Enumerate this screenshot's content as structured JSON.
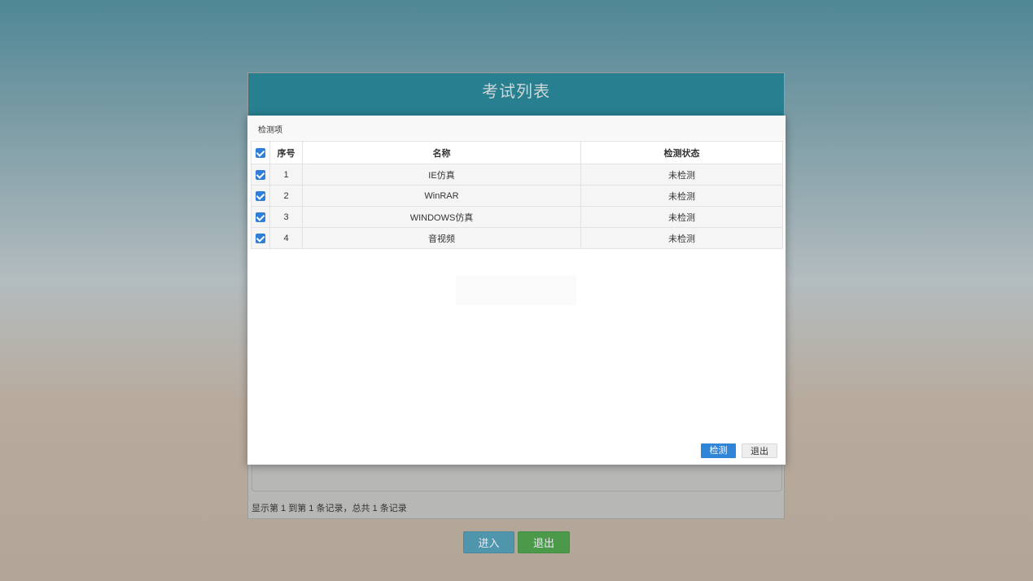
{
  "page": {
    "title": "考试列表",
    "footer_text": "显示第 1 到第 1 条记录，总共 1 条记录",
    "enter_label": "进入",
    "exit_label": "退出"
  },
  "modal": {
    "title": "检测项",
    "columns": [
      "序号",
      "名称",
      "检测状态"
    ],
    "rows": [
      {
        "index": "1",
        "name": "IE仿真",
        "status": "未检测",
        "checked": true
      },
      {
        "index": "2",
        "name": "WinRAR",
        "status": "未检测",
        "checked": true
      },
      {
        "index": "3",
        "name": "WINDOWS仿真",
        "status": "未检测",
        "checked": true
      },
      {
        "index": "4",
        "name": "音视频",
        "status": "未检测",
        "checked": true
      }
    ],
    "detect_label": "检测",
    "quit_label": "退出"
  },
  "colors": {
    "header_teal": "#287f8f",
    "checkbox_blue": "#2f7fd8",
    "detect_blue": "#2f86d8",
    "exit_green": "#4a9a4a"
  }
}
